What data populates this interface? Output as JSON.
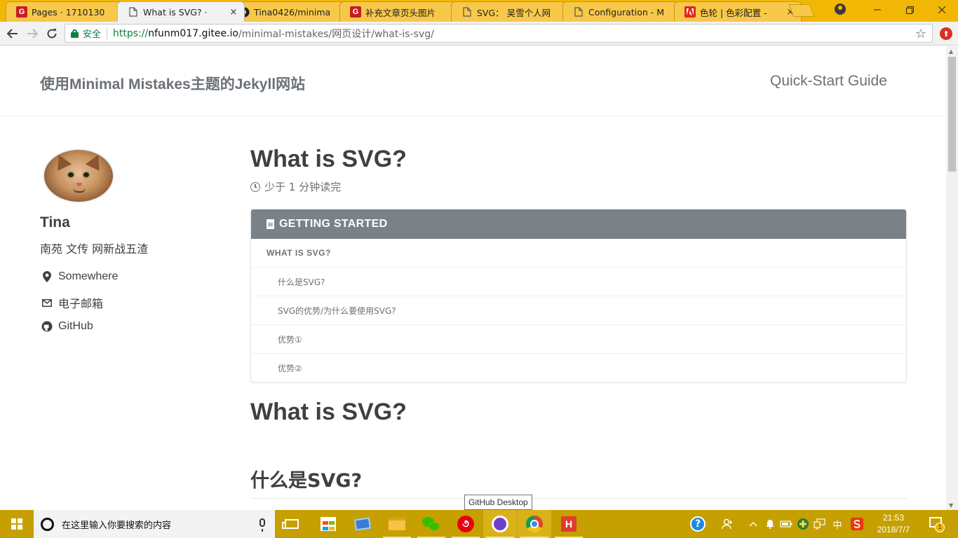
{
  "browser": {
    "tabs": [
      {
        "title": "Pages · 1710130",
        "favicon": "gitee-icon"
      },
      {
        "title": "What is SVG? ·",
        "favicon": "document-icon",
        "active": true
      },
      {
        "title": "Tina0426/minima",
        "favicon": "github-icon"
      },
      {
        "title": "补充文章页头图片",
        "favicon": "gitee-icon"
      },
      {
        "title": "SVG：  吴雪个人网",
        "favicon": "document-icon"
      },
      {
        "title": "Configuration - M",
        "favicon": "document-icon"
      },
      {
        "title": "色轮 | 色彩配置 -",
        "favicon": "adobe-icon"
      }
    ],
    "close_glyph": "×",
    "security_label": "安全",
    "url": {
      "scheme": "https://",
      "host": "nfunm017.gitee.io",
      "path": "/minimal-mistakes/网页设计/what-is-svg/"
    },
    "theme_color": "#f2b705"
  },
  "page": {
    "site_title": "使用Minimal Mistakes主题的Jekyll网站",
    "nav": {
      "quick_start": "Quick-Start Guide"
    },
    "author": {
      "name": "Tina",
      "bio": "南苑 文传 网新战五渣",
      "links": [
        {
          "icon": "map-marker-icon",
          "label": "Somewhere"
        },
        {
          "icon": "envelope-icon",
          "label": "电子邮箱"
        },
        {
          "icon": "github-icon",
          "label": "GitHub"
        }
      ]
    },
    "post": {
      "title": "What is SVG?",
      "read_time": "少于 1 分钟读完",
      "toc": {
        "header": "GETTING STARTED",
        "items": [
          {
            "label": "WHAT IS SVG?",
            "level": 1
          },
          {
            "label": "什么是SVG?",
            "level": 2
          },
          {
            "label": "SVG的优势/为什么要使用SVG?",
            "level": 2
          },
          {
            "label": "优势①",
            "level": 2
          },
          {
            "label": "优势②",
            "level": 2
          }
        ]
      },
      "h1": "What is SVG?",
      "h2": "什么是SVG?"
    },
    "colors": {
      "text": "#3d4144",
      "muted": "#6b7177",
      "toc_header": "#7a8288"
    }
  },
  "tooltip": "GitHub Desktop",
  "taskbar": {
    "search_placeholder": "在这里输入你要搜索的内容",
    "input_indicator": "中",
    "time": "21:53",
    "date": "2018/7/7",
    "notification_count": "1",
    "color": "#c5a000"
  }
}
